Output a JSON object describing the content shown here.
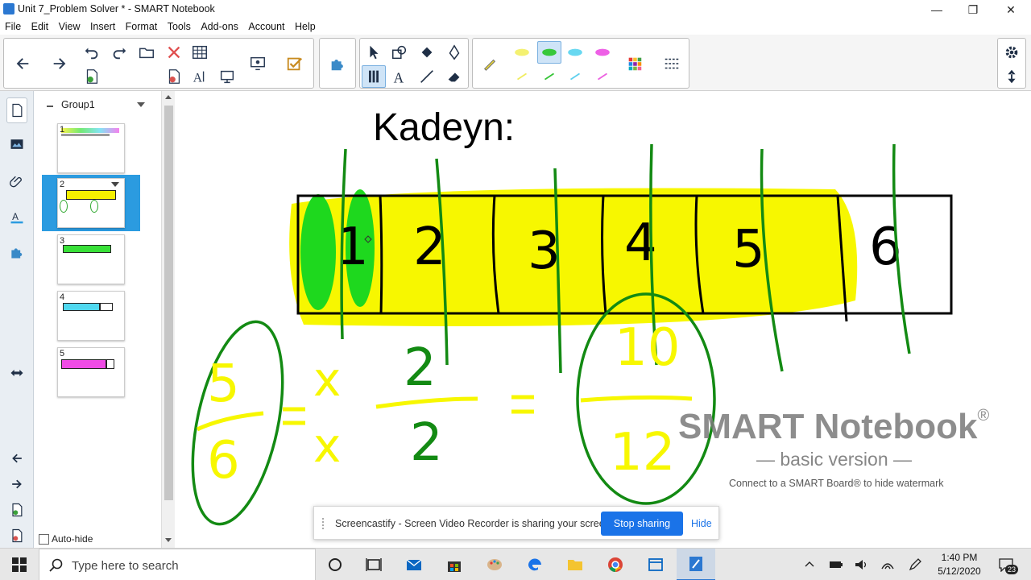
{
  "window": {
    "title": "Unit 7_Problem Solver * - SMART Notebook",
    "minimize": "—",
    "restore": "❐",
    "close": "✕"
  },
  "menu": [
    "File",
    "Edit",
    "View",
    "Insert",
    "Format",
    "Tools",
    "Add-ons",
    "Account",
    "Help"
  ],
  "sorter": {
    "group_label": "Group1",
    "pages": [
      {
        "number": "1",
        "color": "#ffffff"
      },
      {
        "number": "2",
        "color": "#f5f000"
      },
      {
        "number": "3",
        "color": "#38e038"
      },
      {
        "number": "4",
        "color": "#4fd8ef"
      },
      {
        "number": "5",
        "color": "#f04ce6"
      }
    ],
    "autohide_label": "Auto-hide"
  },
  "canvas": {
    "heading": "Kadeyn:",
    "bar_numbers": [
      "1",
      "2",
      "3",
      "4",
      "5",
      "6"
    ],
    "watermark_title": "SMART Notebook",
    "watermark_reg": "®",
    "watermark_sub": "— basic version —",
    "watermark_hint": "Connect to a SMART Board® to hide watermark",
    "ink_colors": {
      "green": "#138a13",
      "yellow": "#f7f700",
      "bright_green": "#1ed81e",
      "black": "#000000"
    }
  },
  "share_bar": {
    "text": "Screencastify - Screen Video Recorder is sharing your screen.",
    "stop_label": "Stop sharing",
    "hide_label": "Hide"
  },
  "taskbar": {
    "search_placeholder": "Type here to search",
    "time": "1:40 PM",
    "date": "5/12/2020",
    "notification_count": "23"
  }
}
